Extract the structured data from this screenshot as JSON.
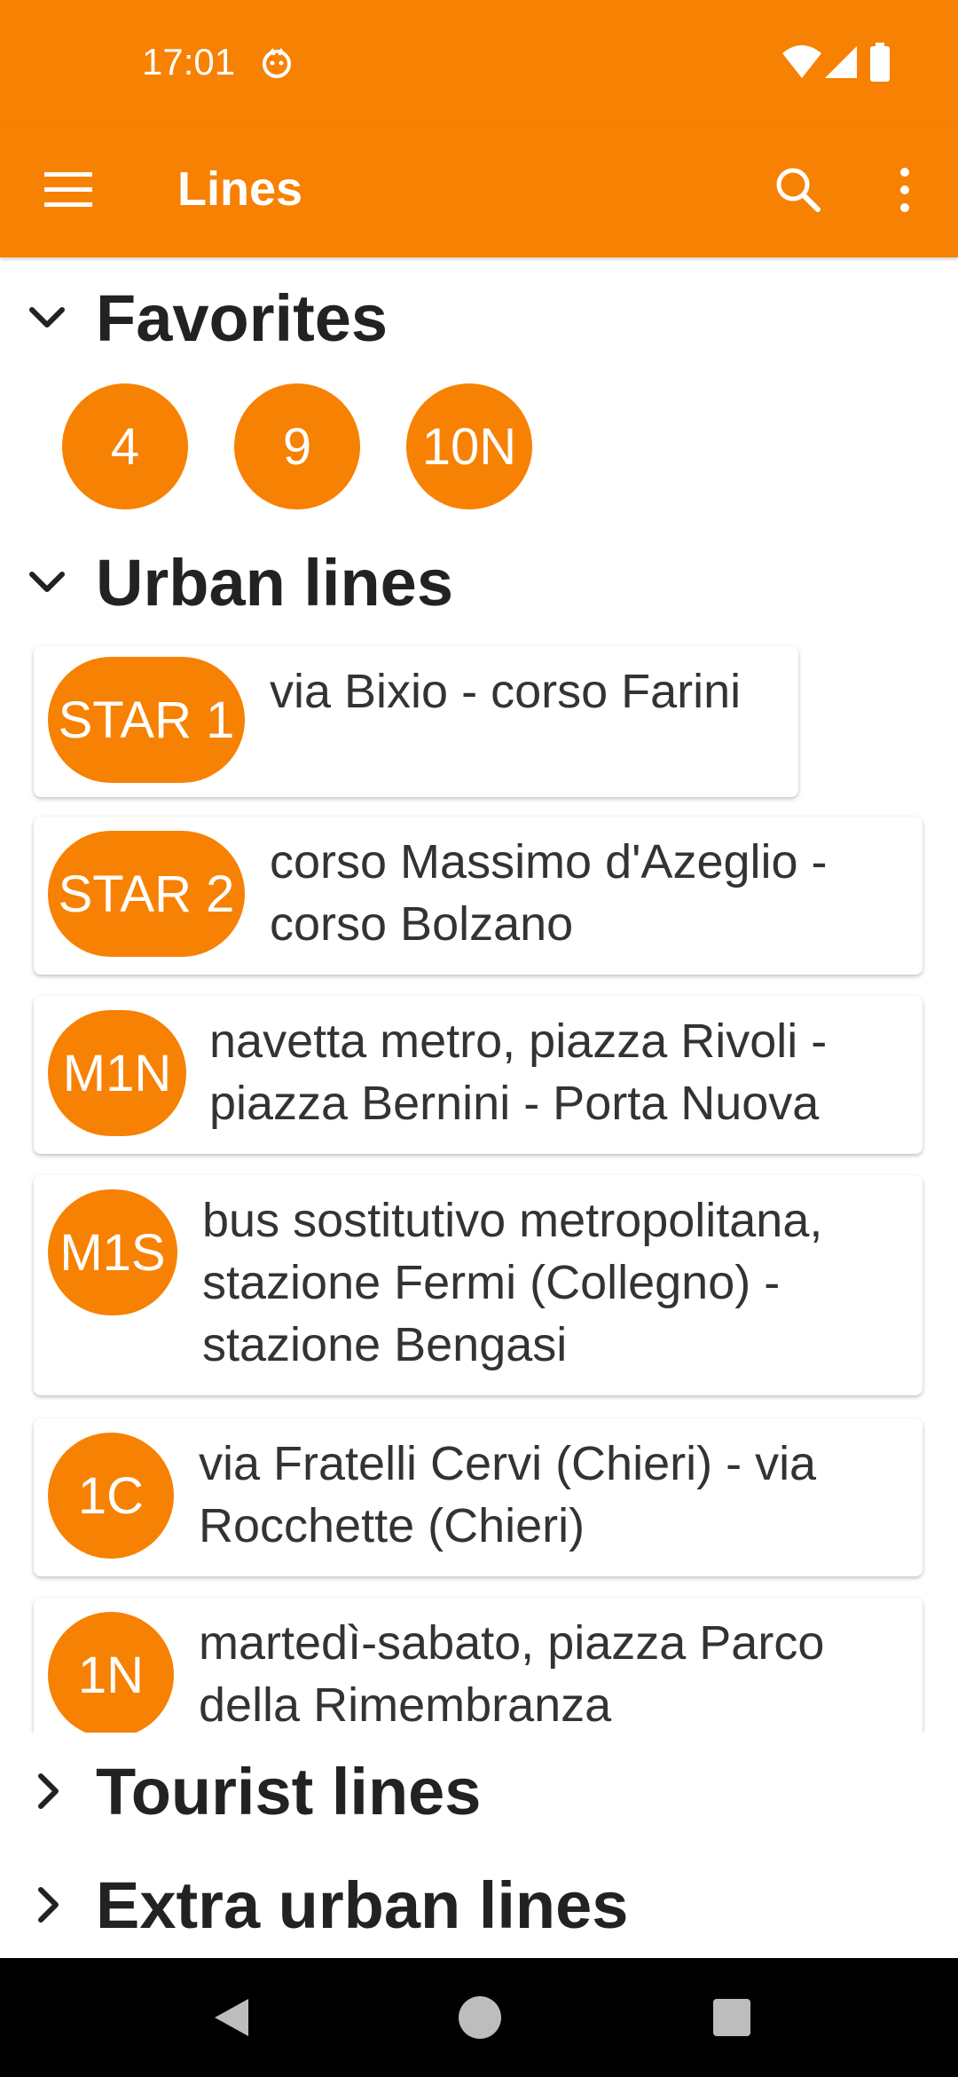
{
  "status_bar": {
    "time": "17:01",
    "icons": [
      "face-notification-icon",
      "wifi-icon",
      "signal-icon",
      "battery-icon"
    ]
  },
  "app_bar": {
    "title": "Lines",
    "icons": [
      "menu-icon",
      "search-icon",
      "more-vert-icon"
    ]
  },
  "colors": {
    "accent": "#F78102",
    "text": "#222222"
  },
  "sections": {
    "favorites": {
      "label": "Favorites",
      "expanded": true
    },
    "urban": {
      "label": "Urban lines",
      "expanded": true
    },
    "tourist": {
      "label": "Tourist lines",
      "expanded": false
    },
    "extra_urban": {
      "label": "Extra urban lines",
      "expanded": false
    }
  },
  "favorites": [
    "4",
    "9",
    "10N"
  ],
  "urban_lines": [
    {
      "code": "STAR 1",
      "description": "via Bixio - corso Farini"
    },
    {
      "code": "STAR 2",
      "description": "corso Massimo d'Azeglio - corso Bolzano"
    },
    {
      "code": "M1N",
      "description": "navetta metro, piazza Rivoli - piazza Bernini - Porta Nuova"
    },
    {
      "code": "M1S",
      "description": "bus sostitutivo metropolitana, stazione Fermi (Collegno) - stazione Bengasi"
    },
    {
      "code": "1C",
      "description": "via Fratelli Cervi (Chieri) - via Rocchette (Chieri)"
    },
    {
      "code": "1N",
      "description": "martedì-sabato, piazza Parco della Rimembranza"
    }
  ],
  "nav_bar": [
    "back-icon",
    "home-icon",
    "recents-icon"
  ]
}
